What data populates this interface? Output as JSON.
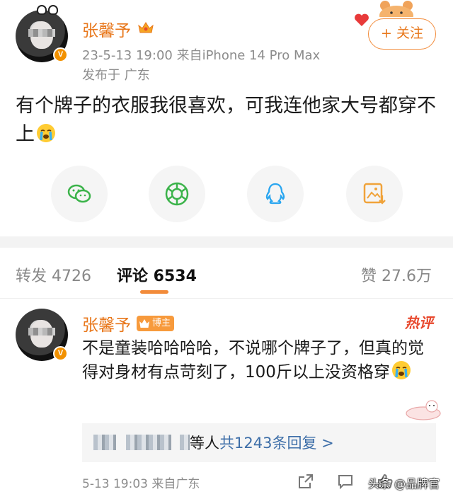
{
  "post": {
    "username": "张馨予",
    "verified_badge": "V",
    "time_device": "23-5-13 19:00  来自iPhone 14 Pro Max",
    "location": "发布于 广东",
    "follow_label": "+ 关注",
    "text": "有个牌子的衣服我很喜欢，可我连他家大号都穿不上"
  },
  "share_icons": [
    "wechat-icon",
    "moments-icon",
    "qq-icon",
    "save-image-icon"
  ],
  "tabs": {
    "repost": "转发 4726",
    "comment": "评论 6534",
    "like": "赞 27.6万"
  },
  "comment": {
    "username": "张馨予",
    "author_badge": "博主",
    "hot_label": "热评",
    "text": "不是童装哈哈哈哈，不说哪个牌子了，但真的觉得对身材有点苛刻了，100斤以上没资格穿",
    "reply_suffix": "等人",
    "reply_count": "共1243条回复 >",
    "meta": "5-13 19:03  来自广东"
  },
  "watermark": "头条 @品牌官",
  "colors": {
    "accent": "#e8771b",
    "link": "#3d6ea8",
    "hot": "#e8492e"
  }
}
